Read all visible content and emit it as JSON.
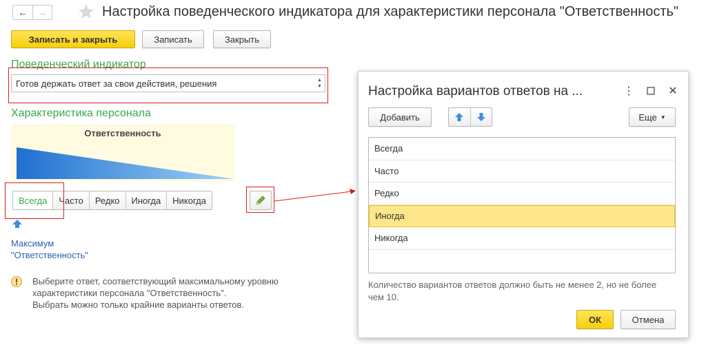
{
  "header": {
    "title": "Настройка поведенческого индикатора для характеристики персонала \"Ответственность\""
  },
  "toolbar": {
    "save_close": "Записать и закрыть",
    "save": "Записать",
    "close": "Закрыть"
  },
  "indicator": {
    "label": "Поведенческий индикатор",
    "value": "Готов держать ответ за свои действия, решения"
  },
  "characteristic": {
    "label": "Характеристика персонала",
    "chart_title": "Ответственность",
    "options": [
      "Всегда",
      "Часто",
      "Редко",
      "Иногда",
      "Никогда"
    ],
    "selected": "Всегда",
    "max_line1": "Максимум",
    "max_line2": "\"Ответственность\""
  },
  "hint": {
    "line1": "Выберите ответ, соответствующий максимальному уровню",
    "line2": "характеристики персонала \"Ответственность\".",
    "line3": "Выбрать можно только крайние варианты ответов."
  },
  "dialog": {
    "title": "Настройка вариантов ответов на ...",
    "add": "Добавить",
    "more": "Еще",
    "items": [
      "Всегда",
      "Часто",
      "Редко",
      "Иногда",
      "Никогда"
    ],
    "selected": "Иногда",
    "note": "Количество вариантов ответов должно быть не менее 2, но не более чем 10.",
    "ok": "ОК",
    "cancel": "Отмена"
  },
  "colors": {
    "accent_green": "#3aa94a",
    "primary_yellow": "#f7cf0a",
    "highlight_red": "#e01b1b",
    "link_blue": "#2b60b0",
    "gradient_blue": "#1f6fd0"
  }
}
